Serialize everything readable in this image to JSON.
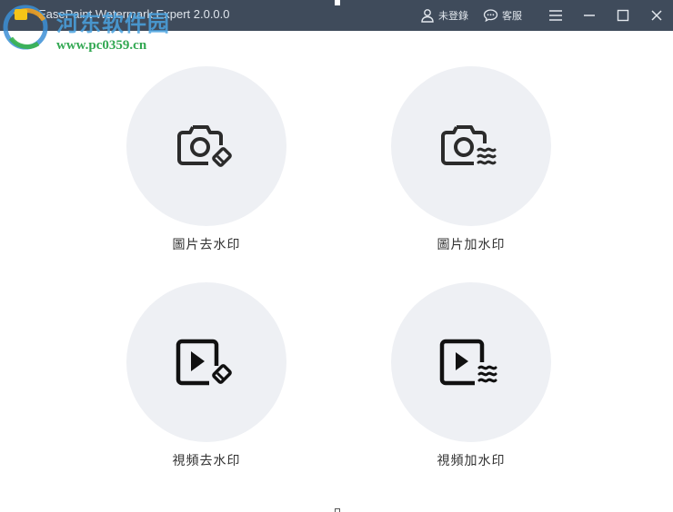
{
  "window": {
    "title": "EasePaint Watermark Expert  2.0.0.0",
    "login_label": "未登錄",
    "support_label": "客服"
  },
  "overlay_watermark": {
    "site_text": "河东软件园",
    "url": "www.pc0359.cn"
  },
  "cards": [
    {
      "label": "圖片去水印",
      "icon": "camera-eraser-icon"
    },
    {
      "label": "圖片加水印",
      "icon": "camera-waves-icon"
    },
    {
      "label": "視頻去水印",
      "icon": "video-eraser-icon"
    },
    {
      "label": "視頻加水印",
      "icon": "video-waves-icon"
    }
  ],
  "colors": {
    "titlebar": "#3f4b5b",
    "circle_bg": "#eef0f4",
    "icon": "#2b2b2b"
  }
}
